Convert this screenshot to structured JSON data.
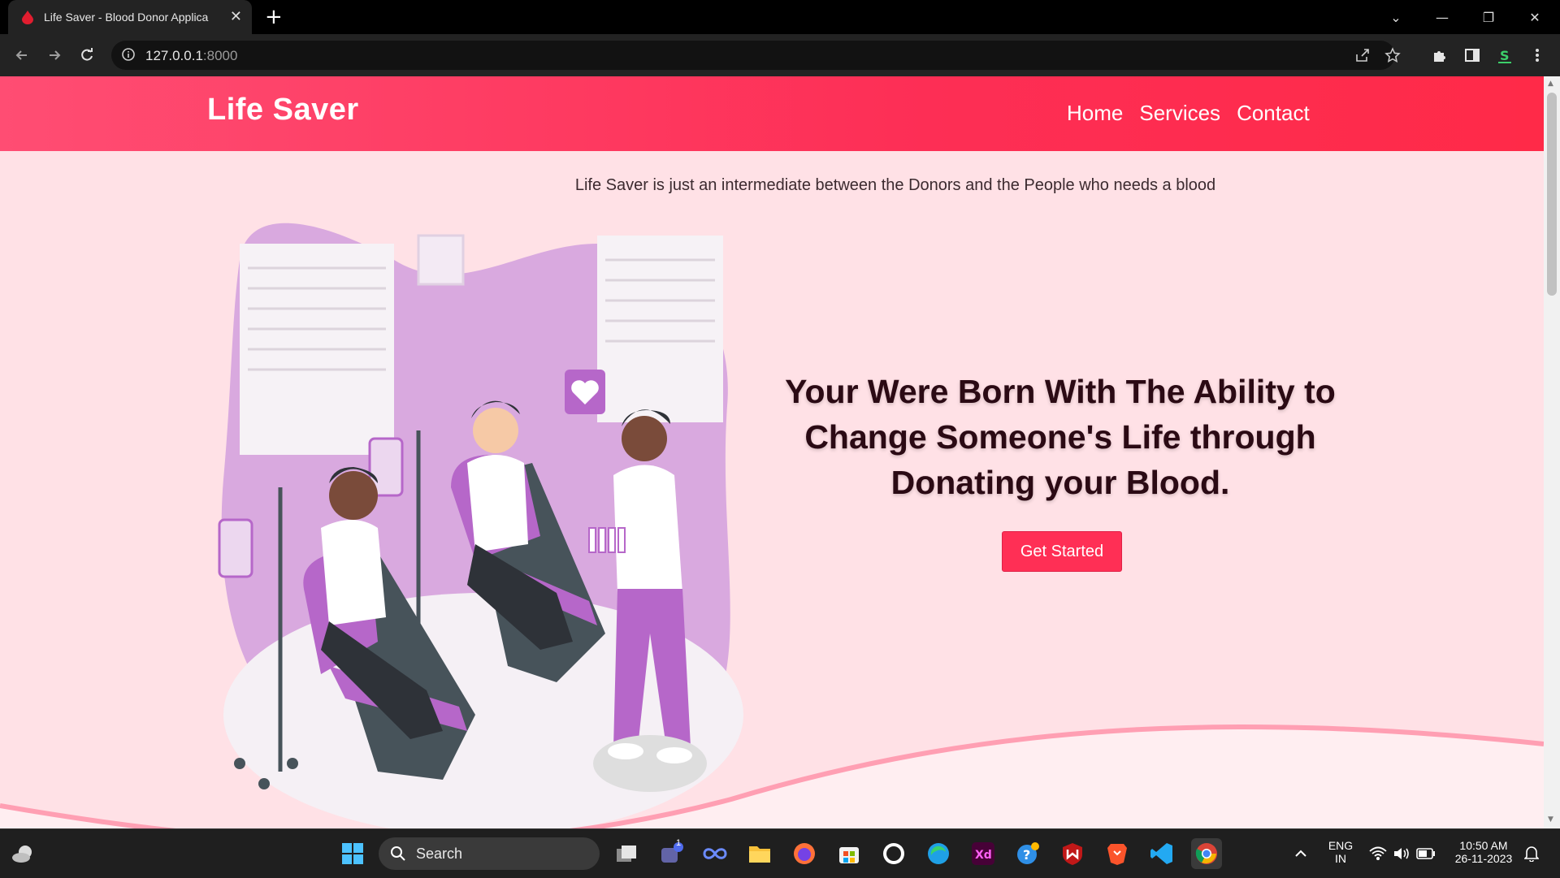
{
  "browser": {
    "tab_title": "Life Saver - Blood Donor Applica",
    "url_host": "127.0.0.1",
    "url_port": ":8000"
  },
  "site": {
    "brand": "Life Saver",
    "nav": [
      "Home",
      "Services",
      "Contact"
    ],
    "tagline": "Life Saver is just an intermediate between the Donors and the People who needs a blood",
    "headline_lines": [
      "Your Were Born With The Ability to",
      "Change Someone's Life through",
      "Donating your Blood."
    ],
    "cta": "Get Started",
    "colors": {
      "primary": "#ff2f55",
      "background": "#ffe1e6",
      "accent_purple": "#b667c9"
    }
  },
  "taskbar": {
    "search_label": "Search",
    "language": "ENG",
    "region": "IN",
    "time": "10:50 AM",
    "date": "26-11-2023",
    "teams_badge": "1"
  }
}
